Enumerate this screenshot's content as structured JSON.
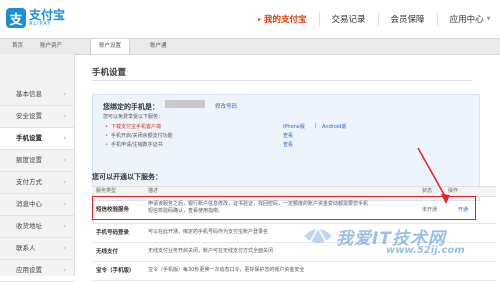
{
  "logo": {
    "cn": "支付宝",
    "en": "ALIPAY",
    "mark": "支"
  },
  "mainnav": [
    {
      "label": "我的支付宝",
      "active": true
    },
    {
      "label": "交易记录"
    },
    {
      "label": "会员保障"
    },
    {
      "label": "应用中心"
    }
  ],
  "subnav": {
    "home": "首页",
    "assets": "账户资产",
    "settings": "账户设置",
    "pass": "账户通"
  },
  "sidebar": {
    "items": [
      {
        "label": "基本信息"
      },
      {
        "label": "安全设置"
      },
      {
        "label": "手机设置"
      },
      {
        "label": "额度设置"
      },
      {
        "label": "支付方式"
      },
      {
        "label": "消息中心"
      },
      {
        "label": "收货地址"
      },
      {
        "label": "联系人"
      },
      {
        "label": "应用设置"
      }
    ]
  },
  "page": {
    "title": "手机设置",
    "bound_label": "您绑定的手机是：",
    "edit_link": "修改号码",
    "enable_hint": "您可以免费享受以下服务：",
    "services": [
      {
        "text": "下载支付宝手机客户端",
        "link1": "iPhone版",
        "sep": "|",
        "link2": "Android版"
      },
      {
        "text": "手机开启/关闭余额支付功能",
        "link1": "查看"
      },
      {
        "text": "手机申请/注销数字证书",
        "link1": "查看"
      }
    ],
    "section2_title": "您可以开通以下服务：",
    "table": {
      "headers": [
        "服务类型",
        "描述",
        "状态",
        "操作"
      ],
      "rows": [
        {
          "type": "短信校验服务",
          "desc": "申请该服务之后，银行账户信息修改，证书验证，找回密码，一定额度的账户资金变动都需要您手机短信校验码确认，查看使用指南。",
          "status": "未开通",
          "op": "开通"
        },
        {
          "type": "手机号码登录",
          "desc": "可以在此开通，绑定的手机号码作为支付宝账户登录名",
          "status": "",
          "op": ""
        },
        {
          "type": "无线支付",
          "desc": "无线支付业务开启关闭，账户可在无线支付方式全面关闭",
          "status": "",
          "op": ""
        },
        {
          "type": "宝令（手机版）",
          "desc": "宝令（手机版）每30秒更换一次动态口令，更好保护您的账户资金安全",
          "status": "",
          "op": ""
        }
      ]
    }
  },
  "watermark": {
    "line1": "我爱IT技术网",
    "line2": "www.52ij.com"
  },
  "colors": {
    "brand": "#1a8fd8",
    "active_nav": "#e03a00",
    "highlight": "#e02424",
    "link": "#2a6bbd"
  }
}
